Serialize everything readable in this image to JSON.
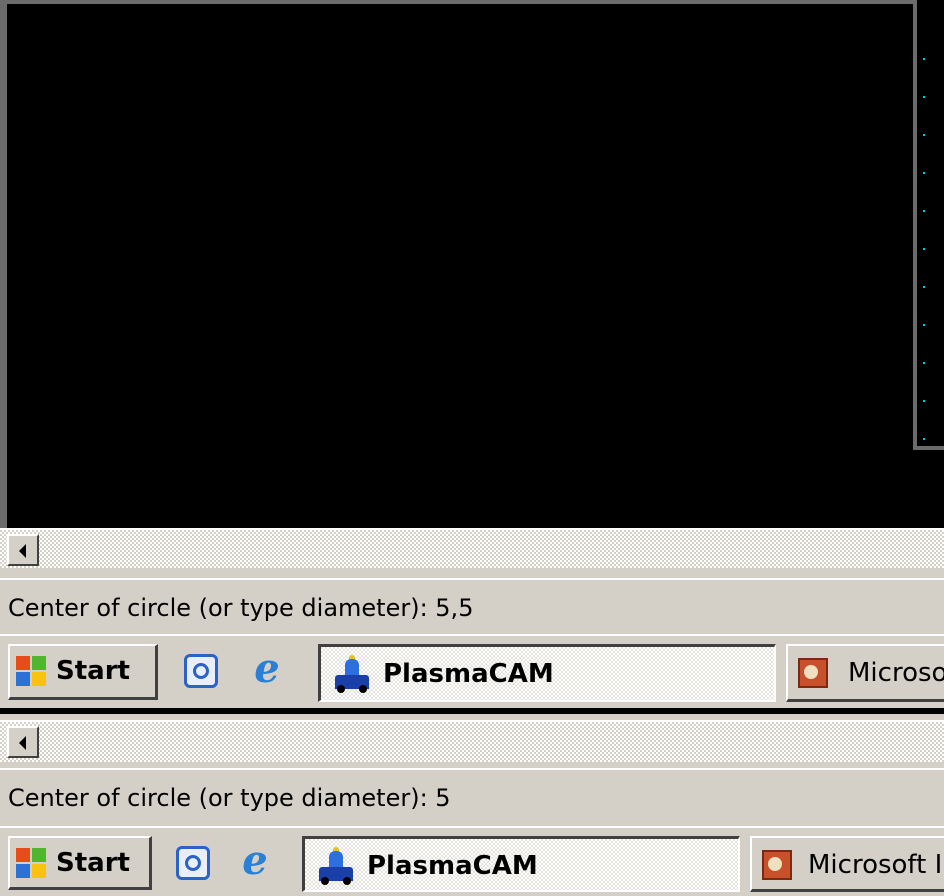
{
  "screen_1": {
    "command_prompt": "Center of circle (or type diameter): 5,5",
    "taskbar": {
      "start_label": "Start",
      "tasks": [
        {
          "label": "PlasmaCAM",
          "active": true
        },
        {
          "label": "Microso",
          "active": false
        }
      ]
    }
  },
  "screen_2": {
    "command_prompt": "Center of circle (or type diameter): 5",
    "taskbar": {
      "start_label": "Start",
      "tasks": [
        {
          "label": "PlasmaCAM",
          "active": true
        },
        {
          "label": "Microsoft I",
          "active": false
        }
      ]
    }
  },
  "icons": {
    "start": "windows-logo-icon",
    "quick_launch": [
      "outlook-express-icon",
      "internet-explorer-icon"
    ],
    "plasmacam": "plasmacam-icon",
    "powerpoint": "powerpoint-icon",
    "scroll_left": "arrow-left-icon"
  },
  "colors": {
    "canvas_background": "#000000",
    "grid_dots": "#00c8e8",
    "chrome": "#d4d0c8"
  }
}
